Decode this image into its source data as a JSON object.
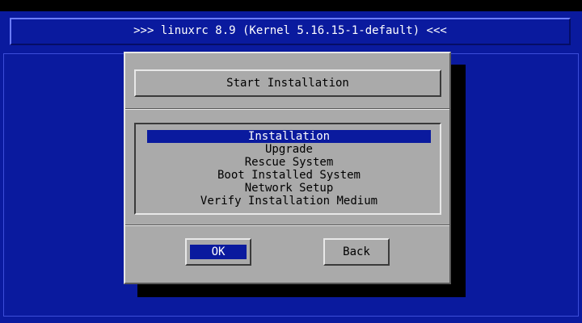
{
  "header": {
    "title": ">>> linuxrc 8.9 (Kernel 5.16.15-1-default) <<<"
  },
  "dialog": {
    "title": "Start Installation",
    "items": [
      {
        "label": "Installation",
        "selected": true
      },
      {
        "label": "Upgrade",
        "selected": false
      },
      {
        "label": "Rescue System",
        "selected": false
      },
      {
        "label": "Boot Installed System",
        "selected": false
      },
      {
        "label": "Network Setup",
        "selected": false
      },
      {
        "label": "Verify Installation Medium",
        "selected": false
      }
    ],
    "buttons": {
      "ok": "OK",
      "back": "Back"
    }
  },
  "colors": {
    "background": "#0a1a9e",
    "dialog": "#aaaaaa",
    "highlight": "#0a1a9e",
    "highlight_text": "#ffffff"
  }
}
